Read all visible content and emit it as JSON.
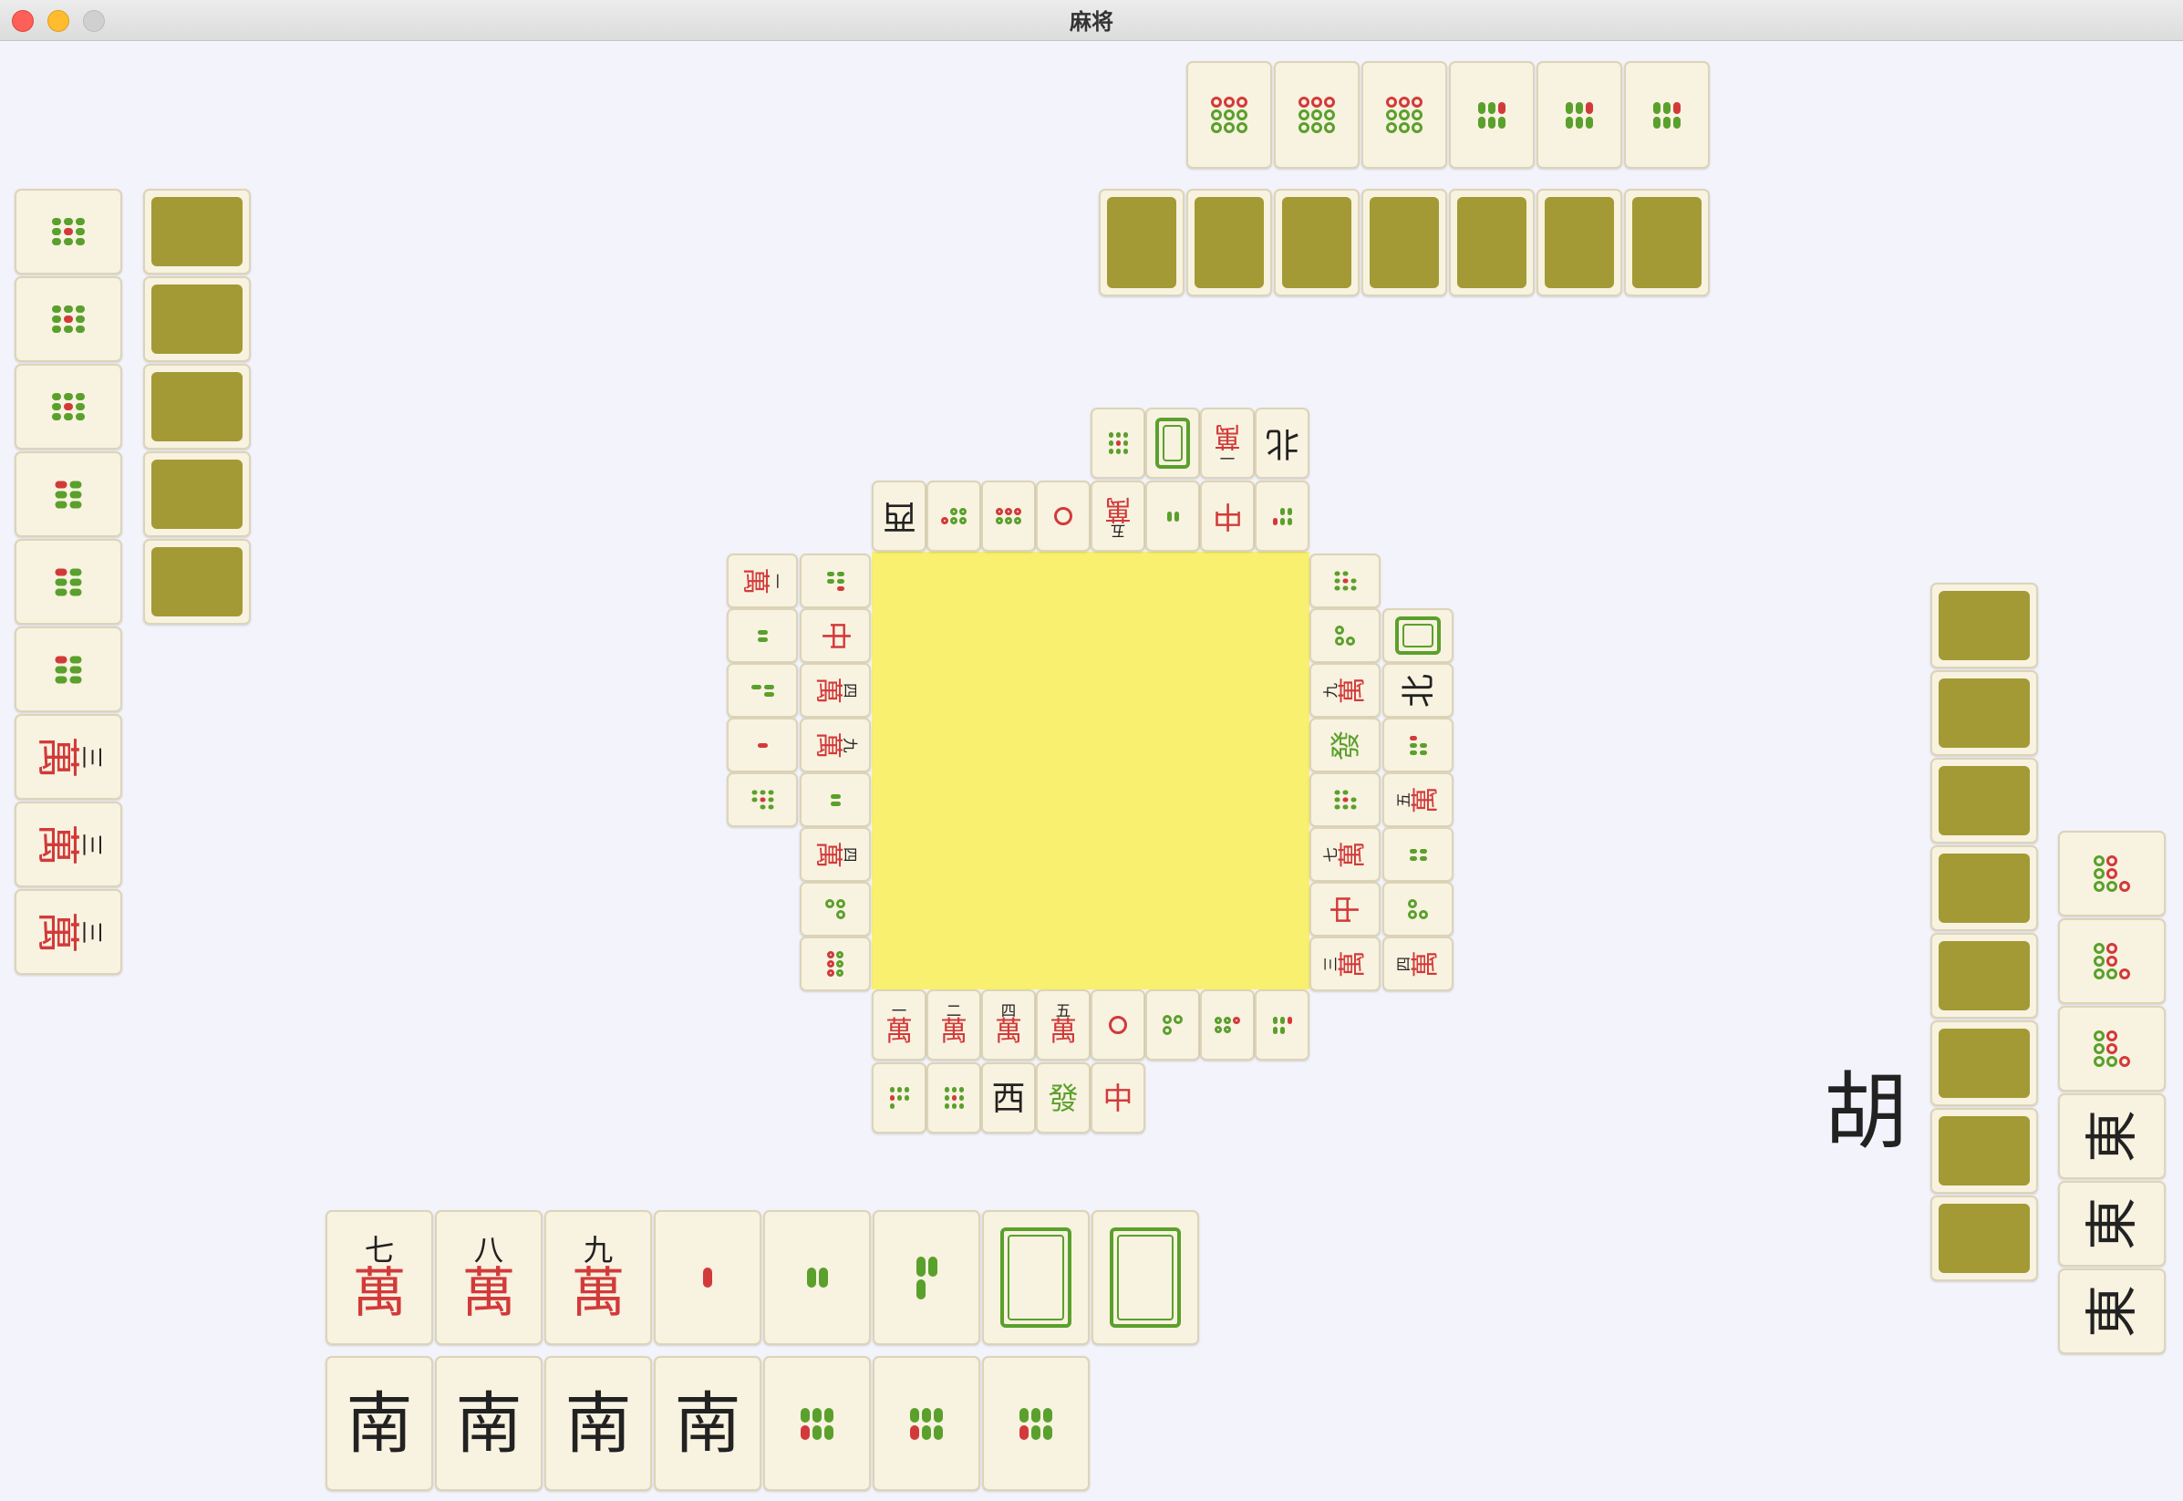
{
  "window": {
    "title": "麻将"
  },
  "status": {
    "hu": "胡"
  },
  "colors": {
    "table": "#f3f3fb",
    "pool": "#f8f06e",
    "tile_back": "#a39a35",
    "tile_face": "#f8f2e0",
    "red": "#d23a3a",
    "green": "#5aa02c"
  },
  "tiles": {
    "top_melds": [
      {
        "kind": "dot",
        "n": 9
      },
      {
        "kind": "dot",
        "n": 9
      },
      {
        "kind": "dot",
        "n": 9
      },
      {
        "kind": "bam",
        "n": 6
      },
      {
        "kind": "bam",
        "n": 6
      },
      {
        "kind": "bam",
        "n": 6
      }
    ],
    "left_melds": [
      {
        "kind": "bam",
        "n": 9
      },
      {
        "kind": "bam",
        "n": 9
      },
      {
        "kind": "bam",
        "n": 9
      },
      {
        "kind": "bam",
        "n": 6
      },
      {
        "kind": "bam",
        "n": 6
      },
      {
        "kind": "bam",
        "n": 6
      },
      {
        "kind": "man",
        "n": "三",
        "s": "萬"
      },
      {
        "kind": "man",
        "n": "三",
        "s": "萬"
      },
      {
        "kind": "man",
        "n": "三",
        "s": "萬"
      }
    ],
    "right_melds": [
      {
        "kind": "dot",
        "n": 7
      },
      {
        "kind": "dot",
        "n": 7
      },
      {
        "kind": "dot",
        "n": 7
      },
      {
        "kind": "wind",
        "t": "東"
      },
      {
        "kind": "wind",
        "t": "東"
      },
      {
        "kind": "wind",
        "t": "東"
      }
    ],
    "player_hand": [
      {
        "kind": "man",
        "n": "七",
        "s": "萬"
      },
      {
        "kind": "man",
        "n": "八",
        "s": "萬"
      },
      {
        "kind": "man",
        "n": "九",
        "s": "萬"
      },
      {
        "kind": "bam",
        "n": 1
      },
      {
        "kind": "bam",
        "n": 2
      },
      {
        "kind": "bam",
        "n": 3
      },
      {
        "kind": "white"
      },
      {
        "kind": "white"
      }
    ],
    "player_melds": [
      {
        "kind": "wind",
        "t": "南"
      },
      {
        "kind": "wind",
        "t": "南"
      },
      {
        "kind": "wind",
        "t": "南"
      },
      {
        "kind": "wind",
        "t": "南"
      },
      {
        "kind": "bam",
        "n": 6
      },
      {
        "kind": "bam",
        "n": 6
      },
      {
        "kind": "bam",
        "n": 6
      }
    ],
    "discards_top_row1": [
      {
        "kind": "bam",
        "n": 9
      },
      {
        "kind": "white"
      },
      {
        "kind": "man",
        "n": "一",
        "s": "萬"
      },
      {
        "kind": "wind",
        "t": "北"
      }
    ],
    "discards_top_row2": [
      {
        "kind": "wind",
        "t": "西"
      },
      {
        "kind": "dot",
        "n": 5
      },
      {
        "kind": "dot",
        "n": 6
      },
      {
        "kind": "dot",
        "n": 1
      },
      {
        "kind": "man",
        "n": "五",
        "s": "萬"
      },
      {
        "kind": "bam",
        "n": 2
      },
      {
        "kind": "dragon",
        "t": "中"
      },
      {
        "kind": "bam",
        "n": 5
      }
    ],
    "discards_left_col1": [
      {
        "kind": "man",
        "n": "一",
        "s": "萬"
      },
      {
        "kind": "bam",
        "n": 2
      },
      {
        "kind": "bam",
        "n": 3
      },
      {
        "kind": "bam",
        "n": 1
      },
      {
        "kind": "bam",
        "n": 8
      }
    ],
    "discards_left_col2": [
      {
        "kind": "bam",
        "n": 5
      },
      {
        "kind": "dragon",
        "t": "中"
      },
      {
        "kind": "man",
        "n": "四",
        "s": "萬"
      },
      {
        "kind": "man",
        "n": "九",
        "s": "萬"
      },
      {
        "kind": "bam",
        "n": 2
      },
      {
        "kind": "man",
        "n": "四",
        "s": "萬"
      },
      {
        "kind": "dot",
        "n": 3
      },
      {
        "kind": "dot",
        "n": 6
      }
    ],
    "discards_bottom_row1": [
      {
        "kind": "man",
        "n": "一",
        "s": "萬"
      },
      {
        "kind": "man",
        "n": "二",
        "s": "萬"
      },
      {
        "kind": "man",
        "n": "四",
        "s": "萬"
      },
      {
        "kind": "man",
        "n": "五",
        "s": "萬"
      },
      {
        "kind": "dot",
        "n": 1
      },
      {
        "kind": "dot",
        "n": 3
      },
      {
        "kind": "dot",
        "n": 5
      },
      {
        "kind": "bam",
        "n": 5
      }
    ],
    "discards_bottom_row2": [
      {
        "kind": "bam",
        "n": 7
      },
      {
        "kind": "bam",
        "n": 9
      },
      {
        "kind": "wind",
        "t": "西"
      },
      {
        "kind": "dragon",
        "t": "發"
      },
      {
        "kind": "dragon",
        "t": "中"
      }
    ],
    "discards_right_col1": [
      {
        "kind": "bam",
        "n": 8
      },
      {
        "kind": "dot",
        "n": 3
      },
      {
        "kind": "man",
        "n": "九",
        "s": "萬"
      },
      {
        "kind": "dragon",
        "t": "發"
      },
      {
        "kind": "bam",
        "n": 8
      },
      {
        "kind": "man",
        "n": "七",
        "s": "萬"
      },
      {
        "kind": "dragon",
        "t": "中"
      },
      {
        "kind": "man",
        "n": "三",
        "s": "萬"
      }
    ],
    "discards_right_col2": [
      {
        "kind": "white"
      },
      {
        "kind": "wind",
        "t": "北"
      },
      {
        "kind": "bam",
        "n": 5
      },
      {
        "kind": "man",
        "n": "五",
        "s": "萬"
      },
      {
        "kind": "bam",
        "n": 4
      },
      {
        "kind": "dot",
        "n": 3
      },
      {
        "kind": "man",
        "n": "四",
        "s": "萬"
      }
    ],
    "top_hidden_count": 7,
    "left_hidden_count": 5,
    "right_hidden_count": 8
  }
}
